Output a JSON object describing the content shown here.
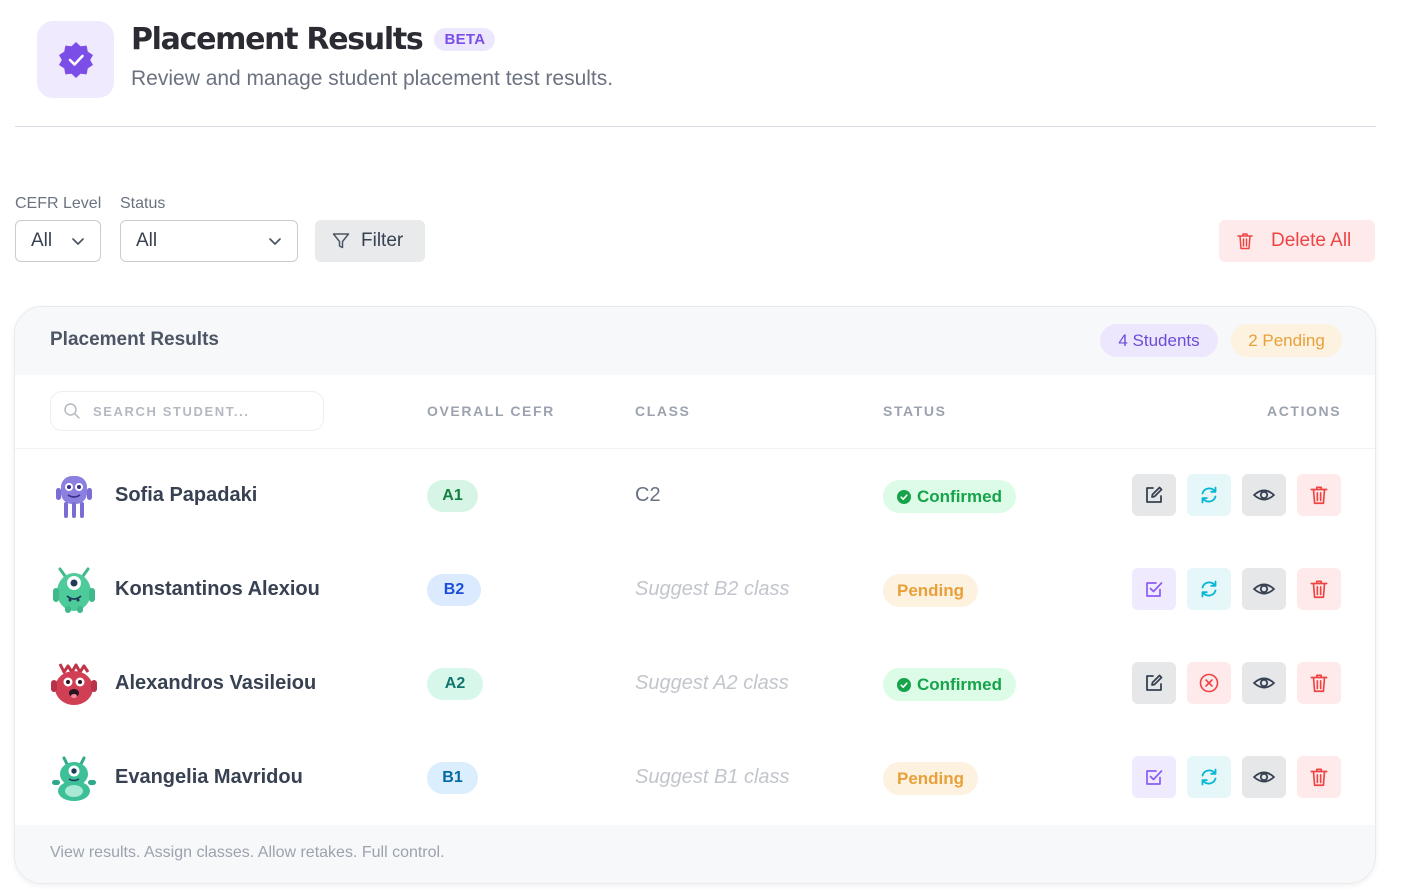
{
  "header": {
    "title": "Placement Results",
    "badge": "BETA",
    "subtitle": "Review and manage student placement test results.",
    "icon": "verified-badge-icon"
  },
  "filters": {
    "cefr_label": "CEFR Level",
    "cefr_value": "All",
    "status_label": "Status",
    "status_value": "All",
    "filter_button": "Filter",
    "delete_all_button": "Delete All"
  },
  "card": {
    "title": "Placement Results",
    "students_pill": "4 Students",
    "pending_pill": "2 Pending",
    "search_placeholder": "SEARCH STUDENT...",
    "columns": {
      "cefr": "OVERALL CEFR",
      "class": "CLASS",
      "status": "STATUS",
      "actions": "ACTIONS"
    },
    "rows": [
      {
        "name": "Sofia Papadaki",
        "level": "A1",
        "class": "C2",
        "status": "Confirmed",
        "avatar": "purple-monster-avatar"
      },
      {
        "name": "Konstantinos Alexiou",
        "level": "B2",
        "class": "Suggest B2 class",
        "status": "Pending",
        "avatar": "green-monster-avatar"
      },
      {
        "name": "Alexandros Vasileiou",
        "level": "A2",
        "class": "Suggest A2 class",
        "status": "Confirmed",
        "avatar": "red-monster-avatar"
      },
      {
        "name": "Evangelia Mavridou",
        "level": "B1",
        "class": "Suggest B1 class",
        "status": "Pending",
        "avatar": "teal-monster-avatar"
      }
    ],
    "footer": "View results. Assign classes. Allow retakes. Full control."
  },
  "colors": {
    "accent": "#7c4ee8",
    "danger": "#ef4444",
    "success": "#16a34a",
    "warning": "#e8a13a",
    "cyan": "#06b6d4"
  }
}
